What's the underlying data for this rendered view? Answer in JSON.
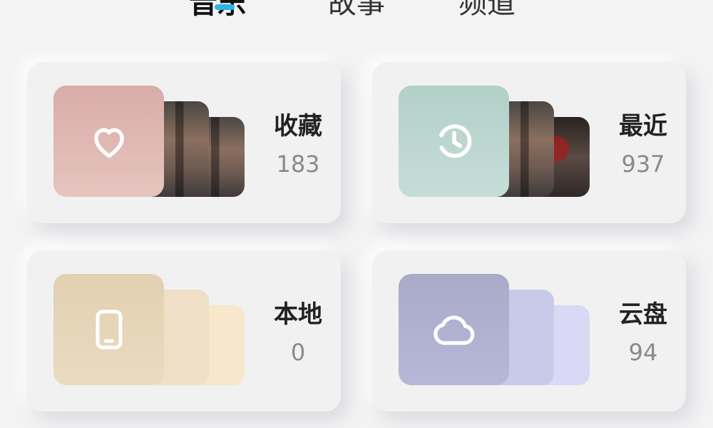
{
  "tabs": [
    {
      "label": "音乐",
      "active": true
    },
    {
      "label": "故事",
      "active": false
    },
    {
      "label": "频道",
      "active": false
    }
  ],
  "accent_color": "#2fb4ea",
  "cards": [
    {
      "label": "收藏",
      "count": "183",
      "icon": "heart-icon",
      "tile_color": "#dcb2ad",
      "thumbnails": "photo"
    },
    {
      "label": "最近",
      "count": "937",
      "icon": "clock-history-icon",
      "tile_color": "#b7d3cc",
      "thumbnails": "photo"
    },
    {
      "label": "本地",
      "count": "0",
      "icon": "phone-icon",
      "tile_color": "#e5d4b6",
      "thumbnails": "plain"
    },
    {
      "label": "云盘",
      "count": "94",
      "icon": "cloud-icon",
      "tile_color": "#aeafcf",
      "thumbnails": "plain"
    }
  ]
}
